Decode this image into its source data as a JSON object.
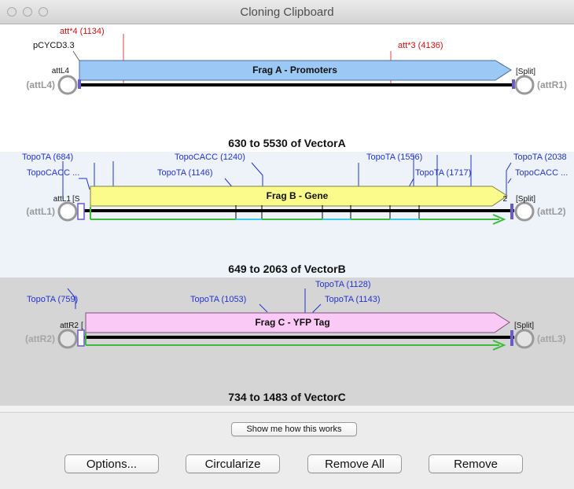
{
  "window": {
    "title": "Cloning Clipboard"
  },
  "fragments": [
    {
      "label": "Frag A - Promoters",
      "range": "630 to 5530 of VectorA",
      "arrow_color": "#9cc8f5",
      "left_site": "attL4",
      "left_outer": "(attL4)",
      "right_site": "[Split]",
      "right_outer": "(attR1)",
      "extra_left": "pCYCD3.3",
      "annotations": [
        {
          "text": "att*4 (1134)",
          "color": "#cc1111"
        },
        {
          "text": "att*3 (4136)",
          "color": "#cc1111"
        }
      ]
    },
    {
      "label": "Frag B - Gene",
      "range": "649 to 2063 of VectorB",
      "arrow_color": "#fbfb8c",
      "left_site": "attL1",
      "left_tag": "[S",
      "left_outer": "(attL1)",
      "right_site": "[Split]",
      "right_tag": "2",
      "right_outer": "(attL2)",
      "annotations": [
        {
          "text": "TopoTA (684)",
          "color": "#2233cc"
        },
        {
          "text": "TopoCACC ...",
          "color": "#2233cc"
        },
        {
          "text": "TopoCACC (1240)",
          "color": "#2233cc"
        },
        {
          "text": "TopoTA (1146)",
          "color": "#2233cc"
        },
        {
          "text": "TopoTA (1556)",
          "color": "#2233cc"
        },
        {
          "text": "TopoTA (1717)",
          "color": "#2233cc"
        },
        {
          "text": "TopoTA (2038",
          "color": "#2233cc"
        },
        {
          "text": "TopoCACC ...",
          "color": "#2233cc"
        }
      ]
    },
    {
      "label": "Frag C - YFP Tag",
      "range": "734 to 1483 of VectorC",
      "arrow_color": "#fbc9f5",
      "left_site": "attR2",
      "left_tag": "[",
      "left_outer": "(attR2)",
      "right_site": "[Split]",
      "right_outer": "(attL3)",
      "annotations": [
        {
          "text": "TopoTA (759)",
          "color": "#2233cc"
        },
        {
          "text": "TopoTA (1053)",
          "color": "#2233cc"
        },
        {
          "text": "TopoTA (1128)",
          "color": "#2233cc"
        },
        {
          "text": "TopoTA (1143)",
          "color": "#2233cc"
        }
      ]
    }
  ],
  "buttons": {
    "show_me": "Show me how this works",
    "options": "Options...",
    "circularize": "Circularize",
    "remove_all": "Remove All",
    "remove": "Remove"
  }
}
